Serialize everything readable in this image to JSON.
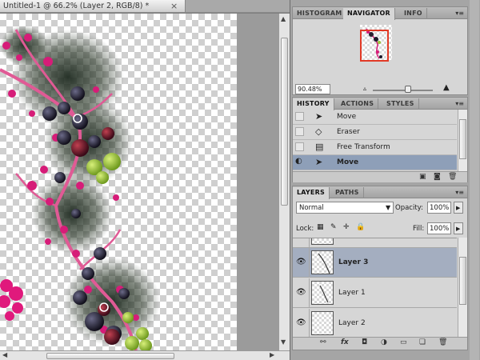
{
  "document": {
    "tab_title": "Untitled-1 @ 66.2% (Layer 2, RGB/8) *",
    "close_glyph": "×"
  },
  "navigator_panel": {
    "tabs": [
      "HISTOGRAM",
      "NAVIGATOR",
      "INFO"
    ],
    "active_tab": "NAVIGATOR",
    "zoom_value": "90.48%",
    "zoom_slider_fraction": 0.55,
    "proxy_color": "#e23a26"
  },
  "history_panel": {
    "tabs": [
      "HISTORY",
      "ACTIONS",
      "STYLES"
    ],
    "active_tab": "HISTORY",
    "items": [
      {
        "label": "Move",
        "icon": "move-tool-icon"
      },
      {
        "label": "Eraser",
        "icon": "eraser-tool-icon"
      },
      {
        "label": "Free Transform",
        "icon": "free-transform-icon"
      },
      {
        "label": "Move",
        "icon": "move-tool-icon",
        "selected": true
      }
    ]
  },
  "layers_panel": {
    "tabs": [
      "LAYERS",
      "PATHS"
    ],
    "active_tab": "LAYERS",
    "blend_mode": "Normal",
    "opacity_label": "Opacity:",
    "opacity_value": "100%",
    "lock_label": "Lock:",
    "fill_label": "Fill:",
    "fill_value": "100%",
    "layers": [
      {
        "name": "",
        "visible": false
      },
      {
        "name": "Layer 3",
        "visible": true,
        "selected": true
      },
      {
        "name": "Layer 1",
        "visible": true
      },
      {
        "name": "Layer 2",
        "visible": true
      }
    ]
  },
  "colors": {
    "selection_row": "#8e9fb8",
    "selected_layer": "#a4aec0",
    "berry_pink": "#d61c78",
    "berry_dark": "#1c1a2a",
    "berry_green": "#9bc43a"
  }
}
